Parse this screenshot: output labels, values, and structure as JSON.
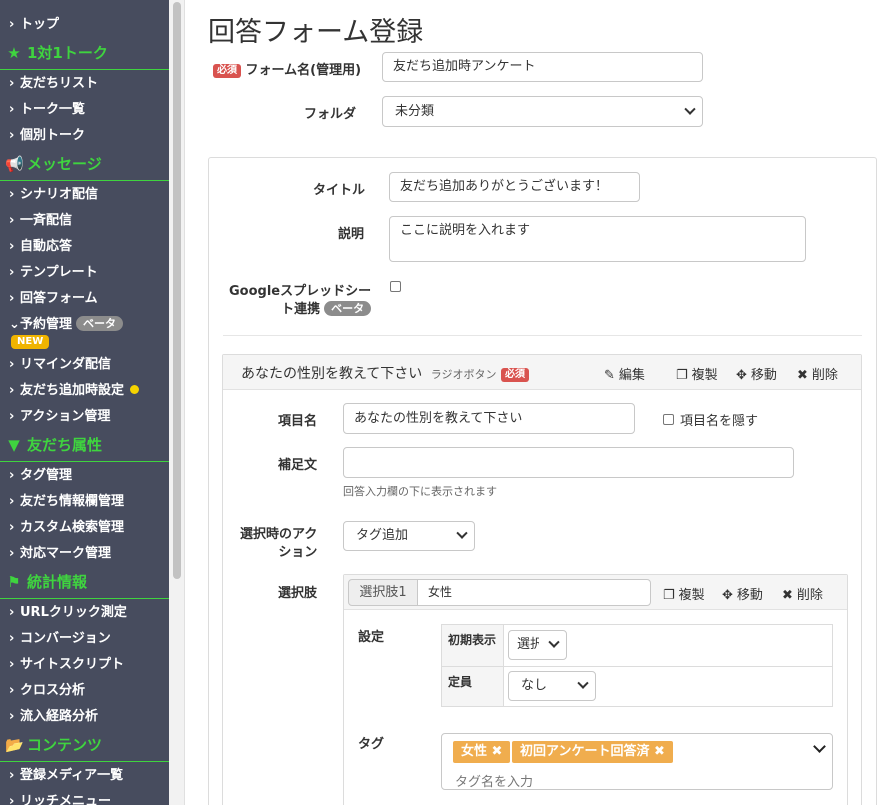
{
  "sidebar": {
    "items": [
      {
        "kind": "item",
        "label": "トップ"
      },
      {
        "kind": "section",
        "icon": "star-icon",
        "glyph": "★",
        "label": "1対1トーク"
      },
      {
        "kind": "item",
        "label": "友だちリスト"
      },
      {
        "kind": "item",
        "label": "トーク一覧"
      },
      {
        "kind": "item",
        "label": "個別トーク"
      },
      {
        "kind": "section",
        "icon": "megaphone-icon",
        "glyph": "📢",
        "label": "メッセージ"
      },
      {
        "kind": "item",
        "label": "シナリオ配信"
      },
      {
        "kind": "item",
        "label": "一斉配信"
      },
      {
        "kind": "item",
        "label": "自動応答"
      },
      {
        "kind": "item",
        "label": "テンプレート"
      },
      {
        "kind": "item",
        "label": "回答フォーム"
      },
      {
        "kind": "item",
        "label": "予約管理",
        "open": true,
        "badge": "ベータ",
        "new_badge": "NEW"
      },
      {
        "kind": "item",
        "label": "リマインダ配信"
      },
      {
        "kind": "item",
        "label": "友だち追加時設定",
        "dot": true
      },
      {
        "kind": "item",
        "label": "アクション管理"
      },
      {
        "kind": "section",
        "icon": "filter-icon",
        "glyph": "▼",
        "label": "友だち属性"
      },
      {
        "kind": "item",
        "label": "タグ管理"
      },
      {
        "kind": "item",
        "label": "友だち情報欄管理"
      },
      {
        "kind": "item",
        "label": "カスタム検索管理"
      },
      {
        "kind": "item",
        "label": "対応マーク管理"
      },
      {
        "kind": "section",
        "icon": "flag-icon",
        "glyph": "⚑",
        "label": "統計情報"
      },
      {
        "kind": "item",
        "label": "URLクリック測定"
      },
      {
        "kind": "item",
        "label": "コンバージョン"
      },
      {
        "kind": "item",
        "label": "サイトスクリプト"
      },
      {
        "kind": "item",
        "label": "クロス分析"
      },
      {
        "kind": "item",
        "label": "流入経路分析"
      },
      {
        "kind": "section",
        "icon": "folder-icon",
        "glyph": "📂",
        "label": "コンテンツ"
      },
      {
        "kind": "item",
        "label": "登録メディア一覧"
      },
      {
        "kind": "item",
        "label": "リッチメニュー"
      }
    ]
  },
  "page": {
    "title": "回答フォーム登録",
    "required_badge": "必須",
    "form_name_label": "フォーム名(管理用)",
    "form_name_value": "友だち追加時アンケート",
    "folder_label": "フォルダ",
    "folder_value": "未分類"
  },
  "panel": {
    "title_label": "タイトル",
    "title_value": "友だち追加ありがとうございます！",
    "desc_label": "説明",
    "desc_value": "ここに説明を入れます",
    "google_label_line1": "Googleスプレッドシー",
    "google_label_line2": "ト連携",
    "google_badge": "ベータ"
  },
  "question": {
    "header_title": "あなたの性別を教えて下さい",
    "header_type": "ラジオボタン",
    "required_badge": "必須",
    "edit_label": "編集",
    "copy_label": "複製",
    "move_label": "移動",
    "delete_label": "削除",
    "item_name_label": "項目名",
    "item_name_value": "あなたの性別を教えて下さい",
    "hide_label": "項目名を隠す",
    "supplement_label": "補足文",
    "supplement_value": "",
    "supplement_help": "回答入力欄の下に表示されます",
    "action_label_line1": "選択時のアク",
    "action_label_line2": "ション",
    "action_value": "タグ追加",
    "options_label": "選択肢"
  },
  "option": {
    "addon": "選択肢1",
    "value": "女性",
    "copy_label": "複製",
    "move_label": "移動",
    "delete_label": "削除",
    "settings_label": "設定",
    "initial_label": "初期表示",
    "initial_value": "選択",
    "capacity_label": "定員",
    "capacity_value": "なし",
    "tag_label": "タグ",
    "tags": [
      "女性 ✖",
      "初回アンケート回答済 ✖"
    ],
    "tag_placeholder": "タグ名を入力"
  }
}
